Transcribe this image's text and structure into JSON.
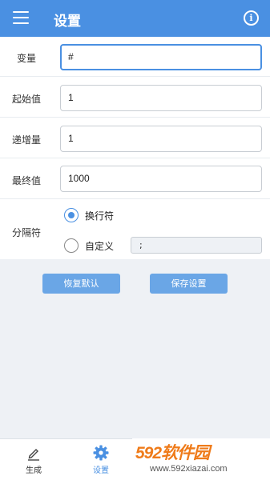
{
  "header": {
    "title": "设置",
    "menu_icon": "hamburger-menu-icon",
    "info_icon": "info-icon"
  },
  "form": {
    "variable": {
      "label": "变量",
      "value": "#"
    },
    "start": {
      "label": "起始值",
      "value": "1"
    },
    "step": {
      "label": "递增量",
      "value": "1"
    },
    "end": {
      "label": "最终值",
      "value": "1000"
    },
    "separator": {
      "label": "分隔符",
      "options": [
        {
          "label": "换行符",
          "selected": true
        },
        {
          "label": "自定义",
          "selected": false
        }
      ],
      "custom_value": ";"
    }
  },
  "buttons": {
    "reset_label": "恢复默认",
    "save_label": "保存设置"
  },
  "bottom_nav": {
    "tabs": [
      {
        "label": "生成",
        "icon": "pencil-icon",
        "active": false
      },
      {
        "label": "设置",
        "icon": "gear-icon",
        "active": true
      }
    ]
  },
  "watermark": {
    "logo": "592软件园",
    "url": "www.592xiazai.com"
  },
  "colors": {
    "accent": "#4a90e2",
    "button": "#6aa6e6",
    "page_background": "#eef1f5",
    "watermark": "#ef7b1a"
  }
}
